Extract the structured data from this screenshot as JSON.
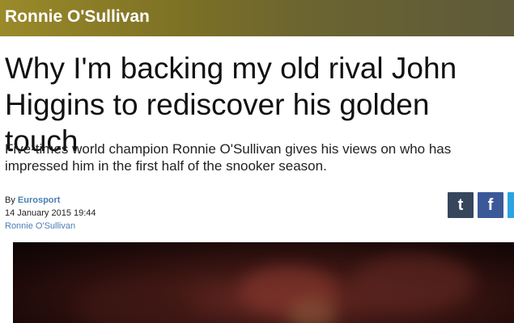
{
  "header": {
    "section_title": "Ronnie O'Sullivan"
  },
  "article": {
    "headline": "Why I'm backing my old rival John Higgins to rediscover his golden touch",
    "standfirst": "Five-times world champion Ronnie O'Sullivan gives his views on who has impressed him in the first half of the snooker season.",
    "byline_prefix": "By",
    "author": "Eurosport",
    "date": "14 January 2015 19:44",
    "tag": "Ronnie O'Sullivan"
  },
  "share": {
    "tumblr_glyph": "t",
    "facebook_glyph": "f",
    "icons": [
      "tumblr-icon",
      "facebook-icon",
      "twitter-icon"
    ],
    "colors": {
      "tumblr": "#36465d",
      "facebook": "#3b5998",
      "twitter": "#2aa3e0"
    }
  },
  "colors": {
    "header_bar": "#7d7125",
    "link": "#4a7fb5"
  }
}
